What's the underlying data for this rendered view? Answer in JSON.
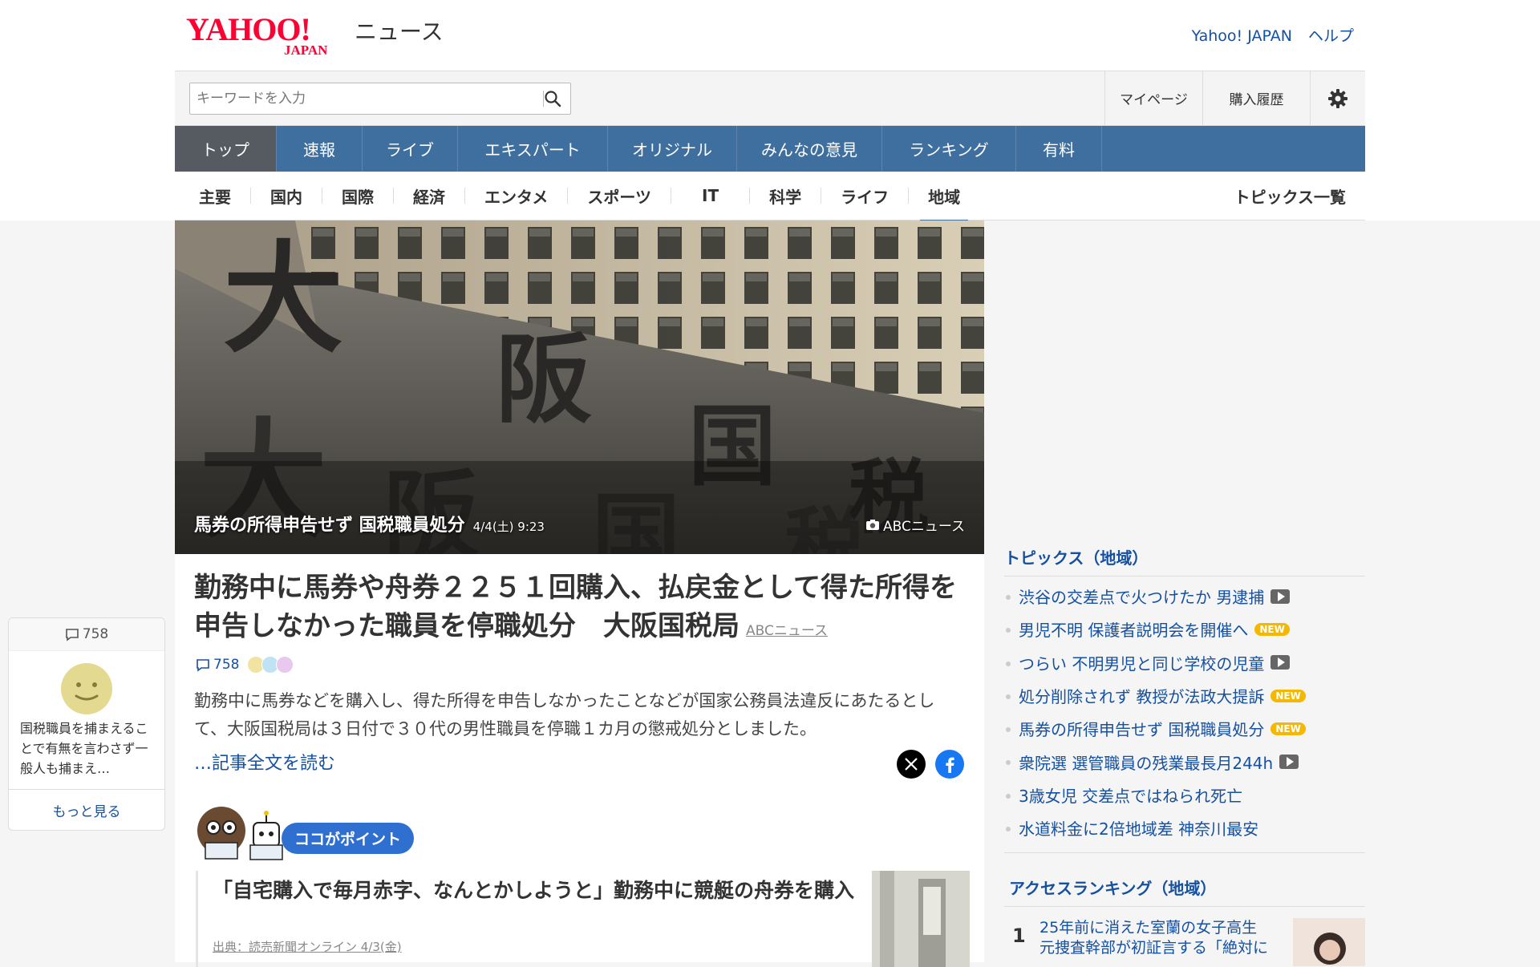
{
  "header": {
    "logo_text": "YAHOO! JAPAN",
    "service_name": "ニュース",
    "links": [
      "Yahoo! JAPAN",
      "ヘルプ"
    ]
  },
  "search": {
    "placeholder": "キーワードを入力",
    "value": ""
  },
  "util_nav": {
    "mypage": "マイページ",
    "history": "購入履歴",
    "settings_icon": "gear-icon"
  },
  "global_nav": [
    {
      "label": "トップ",
      "active": true
    },
    {
      "label": "速報"
    },
    {
      "label": "ライブ"
    },
    {
      "label": "エキスパート"
    },
    {
      "label": "オリジナル"
    },
    {
      "label": "みんなの意見"
    },
    {
      "label": "ランキング"
    },
    {
      "label": "有料"
    }
  ],
  "sub_nav": {
    "items": [
      "主要",
      "国内",
      "国際",
      "経済",
      "エンタメ",
      "スポーツ",
      "IT",
      "科学",
      "ライフ",
      "地域"
    ],
    "active": "地域",
    "topics_all": "トピックス一覧"
  },
  "hero": {
    "caption": "馬券の所得申告せず 国税職員処分",
    "time": "4/4(土) 9:23",
    "credit": "ABCニュース",
    "sign_chars": [
      "大",
      "阪",
      "国",
      "税",
      "大",
      "阪",
      "国",
      "税"
    ]
  },
  "article": {
    "headline": "勤務中に馬券や舟券２２５１回購入、払戻金として得た所得を申告しなかった職員を停職処分　大阪国税局",
    "source": "ABCニュース",
    "comments": "758",
    "summary": "勤務中に馬券などを購入し、得た所得を申告しなかったことなどが国家公務員法違反にあたるとして、大阪国税局は３日付で３０代の男性職員を停職１カ月の懲戒処分としました。",
    "read_more": "…記事全文を読む",
    "point_label": "ココがポイント",
    "related": {
      "title": "「自宅購入で毎月赤字、なんとかしようと」勤務中に競艇の舟券を購入",
      "source": "出典：読売新聞オンライン 4/3(金)"
    }
  },
  "float_comment": {
    "count": "758",
    "text": "国税職員を捕まえることで有無を言わさず一般人も捕まえ…",
    "more": "もっと見る"
  },
  "topics": {
    "title": "トピックス（地域）",
    "items": [
      {
        "label": "渋谷の交差点で火つけたか 男逮捕",
        "badge": "video"
      },
      {
        "label": "男児不明 保護者説明会を開催へ",
        "badge": "new"
      },
      {
        "label": "つらい 不明男児と同じ学校の児童",
        "badge": "video"
      },
      {
        "label": "処分削除されず 教授が法政大提訴",
        "badge": "new"
      },
      {
        "label": "馬券の所得申告せず 国税職員処分",
        "badge": "new"
      },
      {
        "label": "衆院選 選管職員の残業最長月244h",
        "badge": "video"
      },
      {
        "label": "3歳女児 交差点ではねられ死亡",
        "badge": ""
      },
      {
        "label": "水道料金に2倍地域差 神奈川最安",
        "badge": ""
      }
    ],
    "new_label": "NEW"
  },
  "ranking": {
    "title": "アクセスランキング（地域）",
    "items": [
      {
        "rank": "1",
        "text": "25年前に消えた室蘭の女子高生　元捜査幹部が初証言する「絶対に"
      }
    ]
  },
  "colors": {
    "link_blue": "#1650a0",
    "nav_blue": "#3f6f9f",
    "nav_active": "#555b61",
    "yahoo_red": "#ff0033",
    "new_badge": "#f5b800",
    "point_blue": "#2f6fd0"
  }
}
